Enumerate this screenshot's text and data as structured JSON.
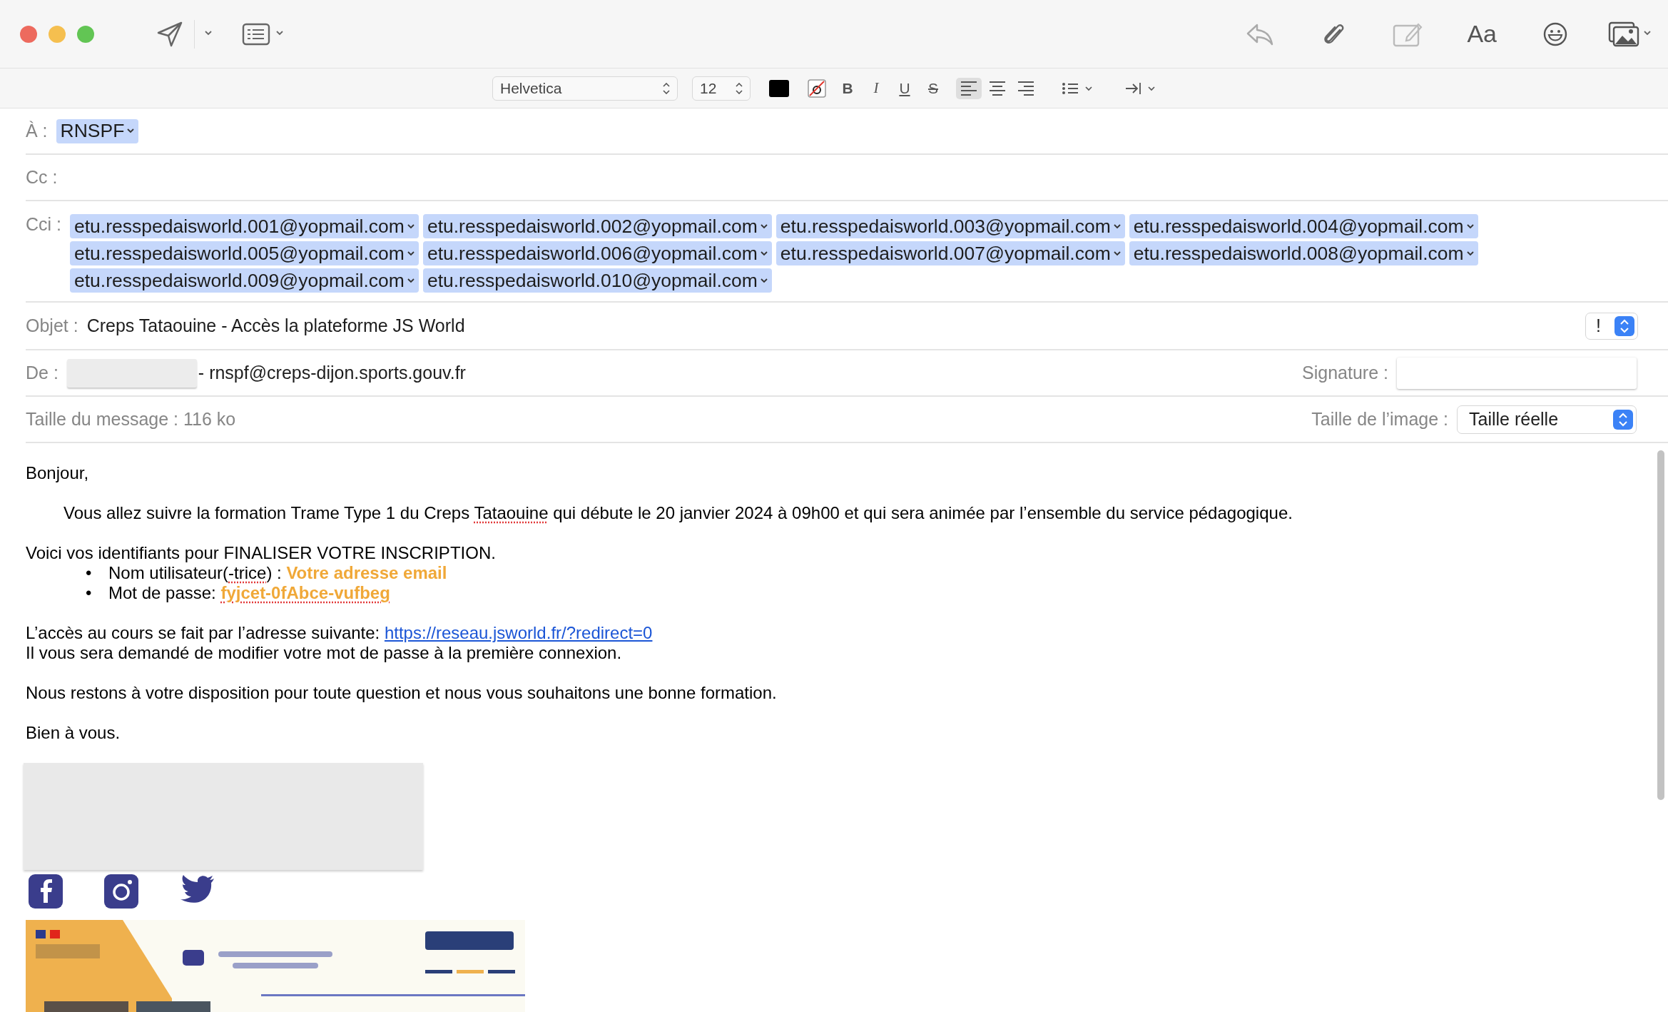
{
  "toolbar": {
    "font_button": "Aa"
  },
  "format_bar": {
    "font": "Helvetica",
    "size": "12",
    "styles": [
      {
        "label": "B",
        "kind": "bold"
      },
      {
        "label": "I",
        "kind": "italic"
      },
      {
        "label": "U",
        "kind": "underline"
      },
      {
        "label": "S",
        "kind": "strike"
      }
    ],
    "alignments": [
      {
        "kind": "left",
        "selected": true
      },
      {
        "kind": "center",
        "selected": false
      },
      {
        "kind": "right",
        "selected": false
      }
    ]
  },
  "header": {
    "to": {
      "label": "À :",
      "recipients": [
        "RNSPF"
      ]
    },
    "cc": {
      "label": "Cc :"
    },
    "bcc": {
      "label": "Cci :",
      "recipients": [
        "etu.resspedaisworld.001@yopmail.com",
        "etu.resspedaisworld.002@yopmail.com",
        "etu.resspedaisworld.003@yopmail.com",
        "etu.resspedaisworld.004@yopmail.com",
        "etu.resspedaisworld.005@yopmail.com",
        "etu.resspedaisworld.006@yopmail.com",
        "etu.resspedaisworld.007@yopmail.com",
        "etu.resspedaisworld.008@yopmail.com",
        "etu.resspedaisworld.009@yopmail.com",
        "etu.resspedaisworld.010@yopmail.com"
      ]
    },
    "subject": {
      "label": "Objet :",
      "value": "Creps Tataouine - Accès la plateforme JS World",
      "priority": "!"
    },
    "from": {
      "label": "De :",
      "value": "- rnspf@creps-dijon.sports.gouv.fr",
      "signature_label": "Signature :"
    },
    "size": {
      "label": "Taille du message : 116 ko",
      "image_size_label": "Taille de l’image :",
      "image_size": "Taille réelle"
    }
  },
  "body": [
    {
      "kind": "plain",
      "lines": [
        {
          "segments": [
            {
              "text": "Bonjour,",
              "kind": "plain",
              "spelling_error": false
            }
          ]
        }
      ]
    },
    {
      "kind": "indented",
      "lines": [
        {
          "segments": [
            {
              "text": "Vous allez suivre la formation Trame Type 1 du Creps ",
              "kind": "plain",
              "spelling_error": false
            },
            {
              "text": "Tataouine",
              "kind": "plain",
              "spelling_error": true
            },
            {
              "text": " qui débute le 20 janvier 2024 à 09h00 et qui sera animée par  l’ensemble du service pédagogique.",
              "kind": "plain",
              "spelling_error": false
            }
          ]
        }
      ]
    },
    {
      "kind": "plain",
      "lines": [
        {
          "segments": [
            {
              "text": "Voici vos identifiants pour FINALISER VOTRE INSCRIPTION.",
              "kind": "plain",
              "spelling_error": false
            }
          ]
        },
        {
          "marker": "•",
          "segments": [
            {
              "text": "Nom utilisateur(",
              "kind": "plain",
              "spelling_error": false
            },
            {
              "text": "-trice",
              "kind": "plain",
              "spelling_error": true
            },
            {
              "text": ") : ",
              "kind": "plain",
              "spelling_error": false
            },
            {
              "text": "Votre adresse email",
              "kind": "highlight",
              "spelling_error": false
            }
          ]
        },
        {
          "marker": "•",
          "segments": [
            {
              "text": "Mot de passe: ",
              "kind": "plain",
              "spelling_error": false
            },
            {
              "text": "fyjcet-0fAbce-vufbeg",
              "kind": "highlight",
              "spelling_error": true
            }
          ]
        }
      ]
    },
    {
      "kind": "plain",
      "lines": [
        {
          "segments": [
            {
              "text": "L’accès au cours se fait par l’adresse suivante: ",
              "kind": "plain",
              "spelling_error": false
            },
            {
              "text": "https://reseau.jsworld.fr/?redirect=0",
              "kind": "link",
              "spelling_error": false
            }
          ]
        },
        {
          "segments": [
            {
              "text": "Il vous sera demandé de modifier votre mot de passe à la première connexion.",
              "kind": "plain",
              "spelling_error": false
            }
          ]
        }
      ]
    },
    {
      "kind": "plain",
      "lines": [
        {
          "segments": [
            {
              "text": "Nous restons à votre disposition pour toute question et nous vous souhaitons une bonne formation.",
              "kind": "plain",
              "spelling_error": false
            }
          ]
        }
      ]
    },
    {
      "kind": "plain",
      "lines": [
        {
          "segments": [
            {
              "text": "Bien à vous.",
              "kind": "plain",
              "spelling_error": false
            }
          ]
        }
      ]
    }
  ]
}
